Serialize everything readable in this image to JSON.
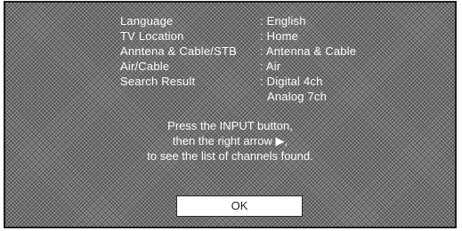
{
  "settings": {
    "rows": [
      {
        "label": "Language",
        "value": ": English"
      },
      {
        "label": "TV Location",
        "value": ": Home"
      },
      {
        "label": "Anntena & Cable/STB",
        "value": ": Antenna & Cable"
      },
      {
        "label": "Air/Cable",
        "value": ": Air"
      },
      {
        "label": "Search Result",
        "value": ": Digital 4ch"
      },
      {
        "label": "",
        "value": "Analog 7ch"
      }
    ]
  },
  "instruction": {
    "line1": "Press the INPUT button,",
    "line2": "then the right arrow ▶,",
    "line3": "to see the list of channels found."
  },
  "ok_button": {
    "label": "OK"
  }
}
